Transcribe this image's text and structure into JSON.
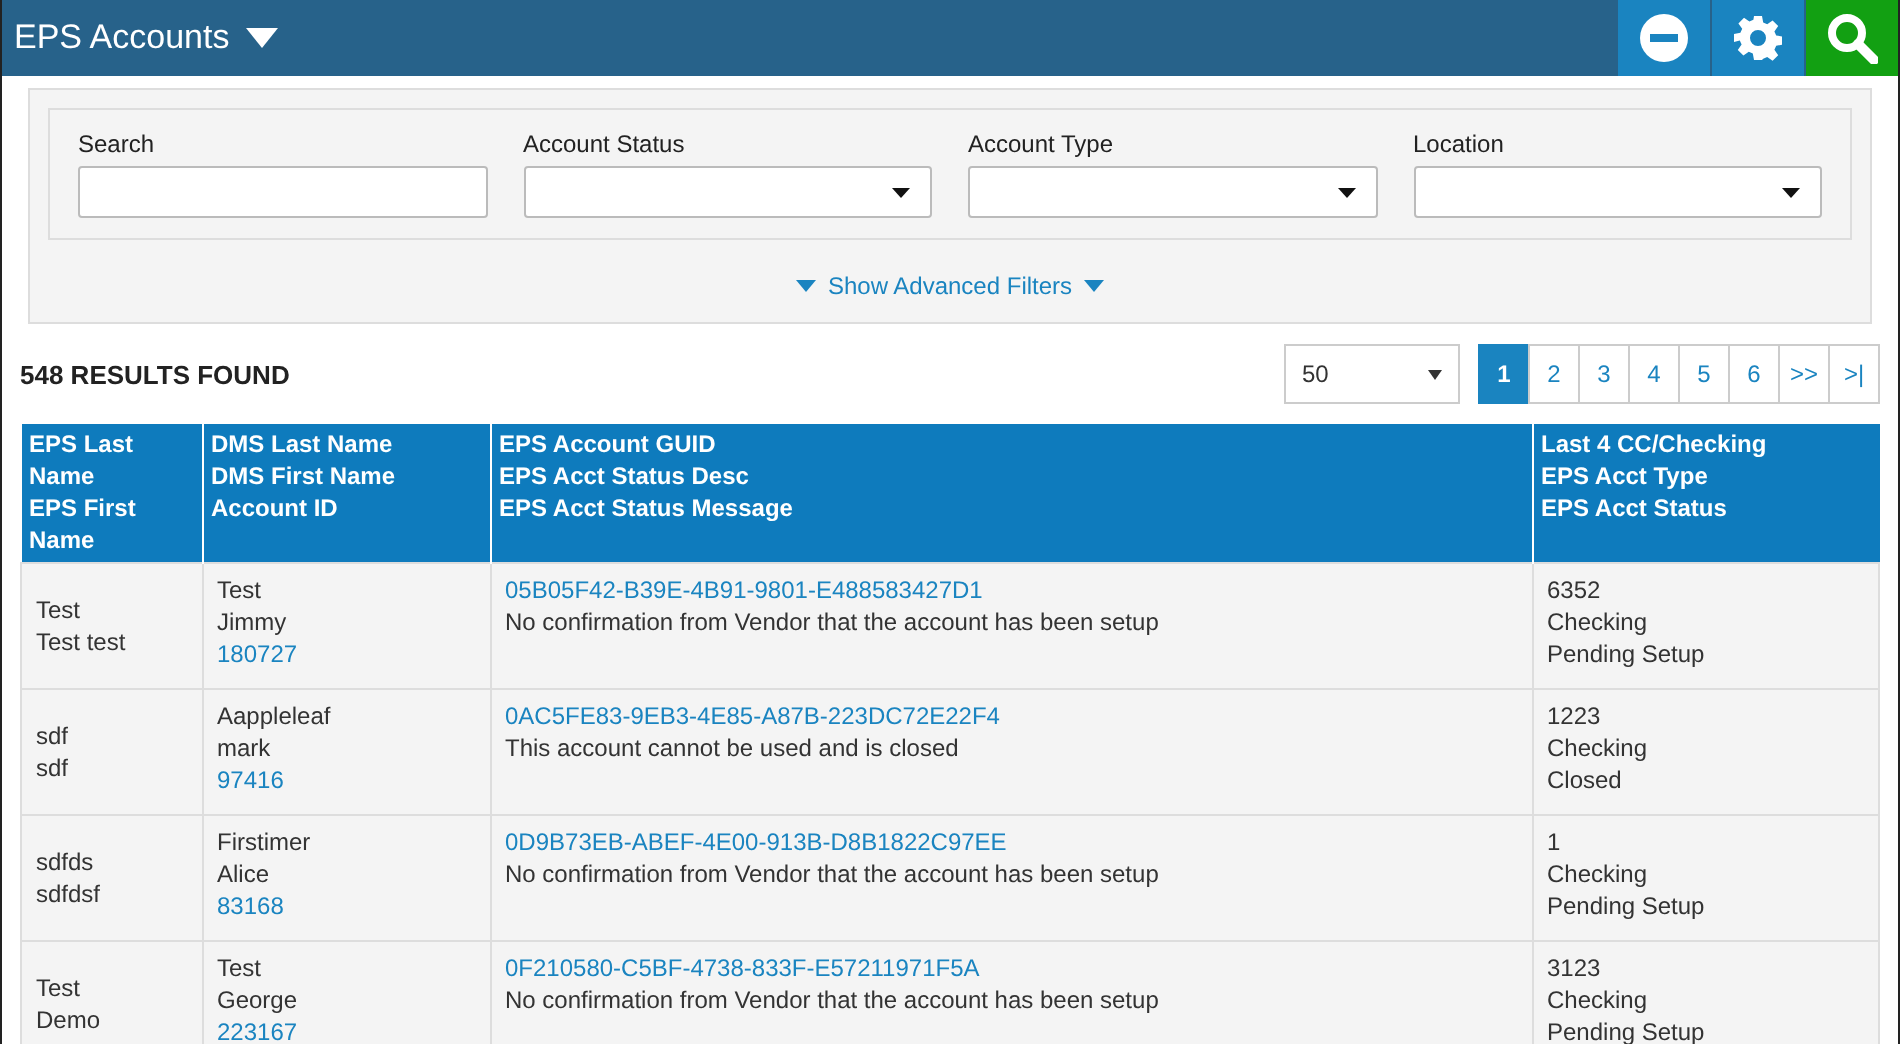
{
  "header": {
    "title": "EPS Accounts"
  },
  "filters": [
    {
      "kind": "text",
      "label": "Search"
    },
    {
      "kind": "select",
      "label": "Account Status"
    },
    {
      "kind": "select",
      "label": "Account Type"
    },
    {
      "kind": "select",
      "label": "Location"
    }
  ],
  "advanced_filters": "Show Advanced Filters",
  "results": "548 RESULTS FOUND",
  "page_size": "50",
  "pages": [
    {
      "label": "1",
      "selected": true
    },
    {
      "label": "2",
      "selected": false
    },
    {
      "label": "3",
      "selected": false
    },
    {
      "label": "4",
      "selected": false
    },
    {
      "label": "5",
      "selected": false
    },
    {
      "label": "6",
      "selected": false
    },
    {
      "label": ">>",
      "selected": false
    },
    {
      "label": ">|",
      "selected": false
    }
  ],
  "table": {
    "columns": [
      [
        "EPS Last Name",
        "EPS First Name"
      ],
      [
        "DMS Last Name",
        "DMS First Name",
        "Account ID"
      ],
      [
        "EPS Account GUID",
        "EPS Acct Status Desc",
        "EPS Acct Status Message"
      ],
      [
        "Last 4 CC/Checking",
        "EPS Acct Type",
        "EPS Acct Status"
      ]
    ],
    "rows": [
      {
        "eps_last": "Test",
        "eps_first": "Test test",
        "dms_last": "Test",
        "dms_first": "Jimmy",
        "account_id": "180727",
        "guid": "05B05F42-B39E-4B91-9801-E488583427D1",
        "status_message": "No confirmation from Vendor that the account has been setup",
        "last4": "6352",
        "acct_type": "Checking",
        "acct_status": "Pending Setup"
      },
      {
        "eps_last": "sdf",
        "eps_first": "sdf",
        "dms_last": "Aappleleaf",
        "dms_first": "mark",
        "account_id": "97416",
        "guid": "0AC5FE83-9EB3-4E85-A87B-223DC72E22F4",
        "status_message": "This account cannot be used and is closed",
        "last4": "1223",
        "acct_type": "Checking",
        "acct_status": "Closed"
      },
      {
        "eps_last": "sdfds",
        "eps_first": "sdfdsf",
        "dms_last": "Firstimer",
        "dms_first": "Alice",
        "account_id": "83168",
        "guid": "0D9B73EB-ABEF-4E00-913B-D8B1822C97EE",
        "status_message": "No confirmation from Vendor that the account has been setup",
        "last4": "1",
        "acct_type": "Checking",
        "acct_status": "Pending Setup"
      },
      {
        "eps_last": "Test",
        "eps_first": "Demo",
        "dms_last": "Test",
        "dms_first": "George",
        "account_id": "223167",
        "guid": "0F210580-C5BF-4738-833F-E57211971F5A",
        "status_message": "No confirmation from Vendor that the account has been setup",
        "last4": "3123",
        "acct_type": "Checking",
        "acct_status": "Pending Setup"
      }
    ]
  }
}
